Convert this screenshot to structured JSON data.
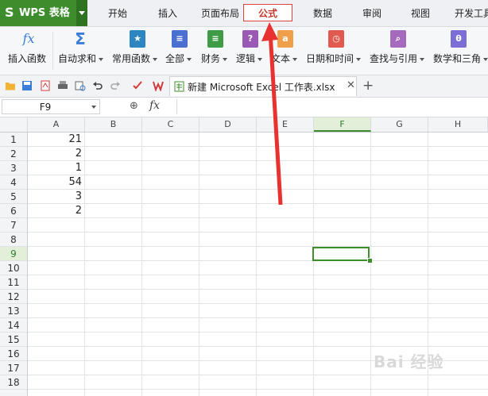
{
  "app": {
    "name": "WPS 表格",
    "logo_glyph": "S"
  },
  "menu": {
    "tabs": [
      "开始",
      "插入",
      "页面布局",
      "公式",
      "数据",
      "审阅",
      "视图",
      "开发工具"
    ],
    "active": "公式"
  },
  "ribbon": {
    "items": [
      {
        "label": "插入函数",
        "icon": "fx-icon",
        "color": "#3b7dd8"
      },
      {
        "label": "自动求和",
        "icon": "sigma-icon",
        "color": "#3b7dd8"
      },
      {
        "label": "常用函数",
        "icon": "star-book-icon",
        "color": "#2e86c1"
      },
      {
        "label": "全部",
        "icon": "book-icon",
        "color": "#4a6fd0"
      },
      {
        "label": "财务",
        "icon": "finance-book-icon",
        "color": "#3f9b45"
      },
      {
        "label": "逻辑",
        "icon": "logic-book-icon",
        "color": "#9b59b6"
      },
      {
        "label": "文本",
        "icon": "text-book-icon",
        "color": "#f0a04b"
      },
      {
        "label": "日期和时间",
        "icon": "clock-book-icon",
        "color": "#e05a4f"
      },
      {
        "label": "查找与引用",
        "icon": "search-book-icon",
        "color": "#a569bd"
      },
      {
        "label": "数学和三角",
        "icon": "theta-book-icon",
        "color": "#7b6fd6"
      }
    ],
    "glyphs": [
      "fx",
      "Σ",
      "★",
      "≡",
      "≡",
      "?",
      "a",
      "◷",
      "⌕",
      "θ"
    ]
  },
  "document": {
    "tab_name": "新建 Microsoft Excel 工作表.xlsx",
    "close": "✕",
    "new_tab": "+"
  },
  "formula_bar": {
    "cell_ref": "F9",
    "fx": "fx",
    "zoom": "⊕",
    "content": ""
  },
  "grid": {
    "columns": [
      "A",
      "B",
      "C",
      "D",
      "E",
      "F",
      "G",
      "H"
    ],
    "selected_column": "F",
    "rows": [
      "1",
      "2",
      "3",
      "4",
      "5",
      "6",
      "7",
      "8",
      "9",
      "10",
      "11",
      "12",
      "13",
      "14",
      "15",
      "16",
      "17",
      "18"
    ],
    "selected_row": "9",
    "column_a_values": [
      "21",
      "2",
      "1",
      "54",
      "3",
      "2"
    ]
  },
  "watermark": "Bai 经验"
}
